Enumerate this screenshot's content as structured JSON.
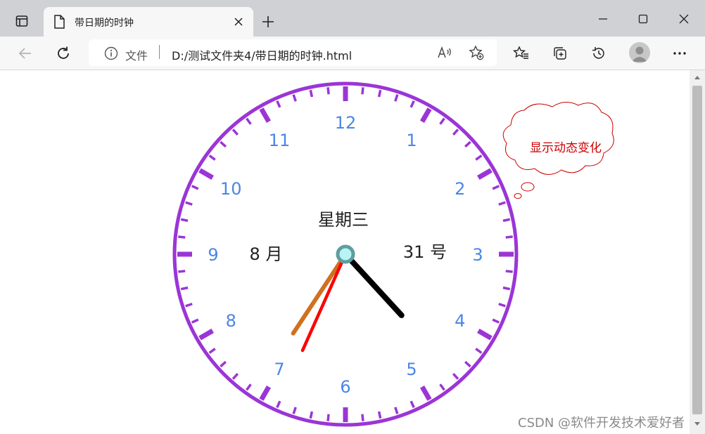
{
  "browser": {
    "tab_title": "带日期的时钟",
    "address": {
      "scheme_label": "文件",
      "url": "D:/测试文件夹4/带日期的时钟.html"
    }
  },
  "clock": {
    "weekday": "星期三",
    "month_label": "8 月",
    "day_label": "31 号",
    "hour_numbers": [
      "12",
      "1",
      "2",
      "3",
      "4",
      "5",
      "6",
      "7",
      "8",
      "9",
      "10",
      "11"
    ],
    "time": {
      "hour": 4,
      "minute": 35,
      "second": 34
    },
    "colors": {
      "rim": "#9b35d6",
      "ticks": "#9b35d6",
      "numbers": "#4a86e8",
      "hour_hand": "#000000",
      "minute_hand": "#d07020",
      "second_hand": "#ff0000",
      "center_outer": "#5f9ea0",
      "center_inner": "#b8f4f4"
    }
  },
  "callout": {
    "text": "显示动态变化",
    "color": "#cc0000"
  },
  "watermark": "CSDN @软件开发技术爱好者"
}
